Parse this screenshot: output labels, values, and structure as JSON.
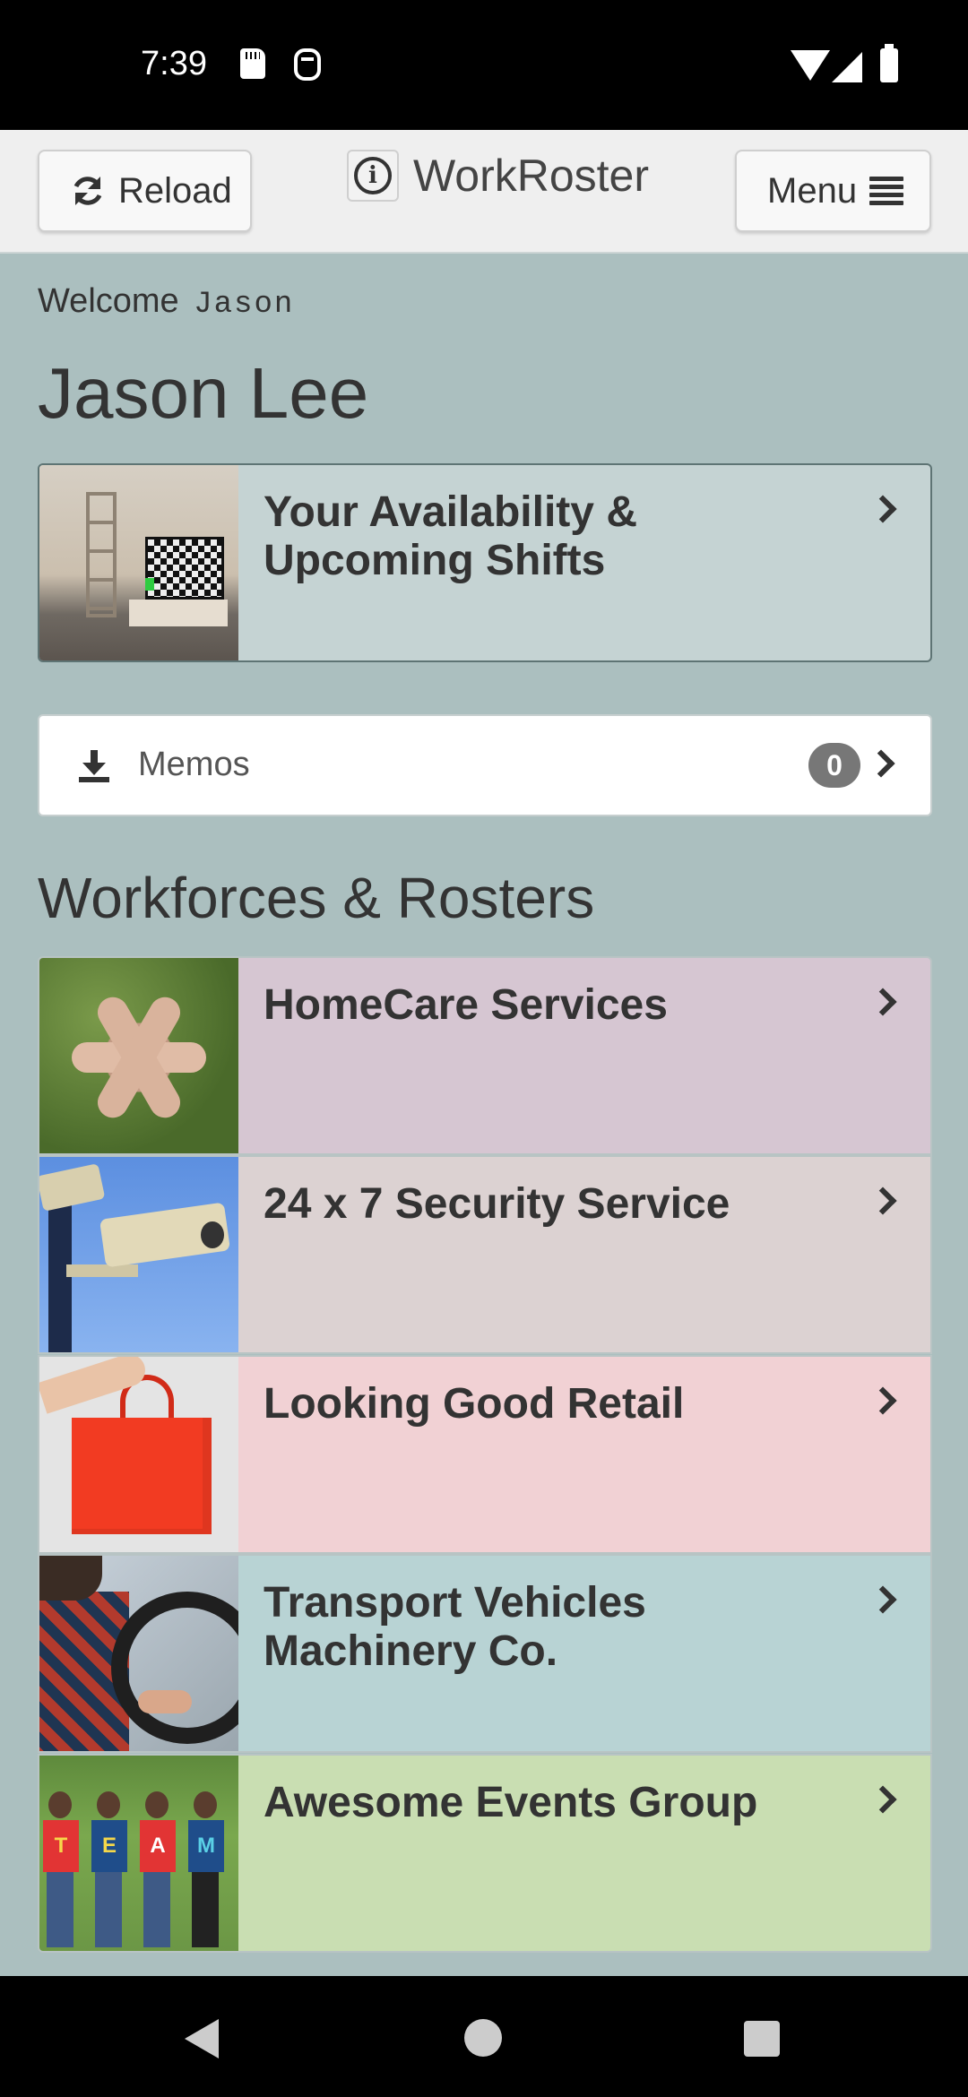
{
  "status_bar": {
    "time": "7:39",
    "icons": [
      "sd-card-icon",
      "debug-icon",
      "wifi-icon",
      "signal-icon",
      "battery-icon"
    ]
  },
  "header": {
    "reload_label": "Reload",
    "app_title": "WorkRoster",
    "menu_label": "Menu"
  },
  "welcome": {
    "prefix": "Welcome",
    "username": "Jason",
    "full_name": "Jason Lee"
  },
  "availability": {
    "label": "Your Availability & Upcoming Shifts"
  },
  "memos": {
    "label": "Memos",
    "count": "0"
  },
  "section": {
    "title": "Workforces & Rosters"
  },
  "rosters": [
    {
      "label": "HomeCare Services",
      "color": "#d6c6d2"
    },
    {
      "label": "24 x 7 Security Service",
      "color": "#dcd2d2"
    },
    {
      "label": "Looking Good Retail",
      "color": "#f1d1d4"
    },
    {
      "label": "Transport Vehicles Machinery Co.",
      "color": "#b8d3d4"
    },
    {
      "label": "Awesome Events Group",
      "color": "#c9deb2"
    }
  ],
  "team_shirt_letters": [
    "T",
    "E",
    "A",
    "M"
  ],
  "colors": {
    "background": "#abbfbf",
    "header_bg": "#efefef",
    "availability_bg": "#c5d3d3",
    "badge": "#777777"
  },
  "nav": {
    "icons": [
      "back-icon",
      "home-icon",
      "recents-icon"
    ]
  }
}
